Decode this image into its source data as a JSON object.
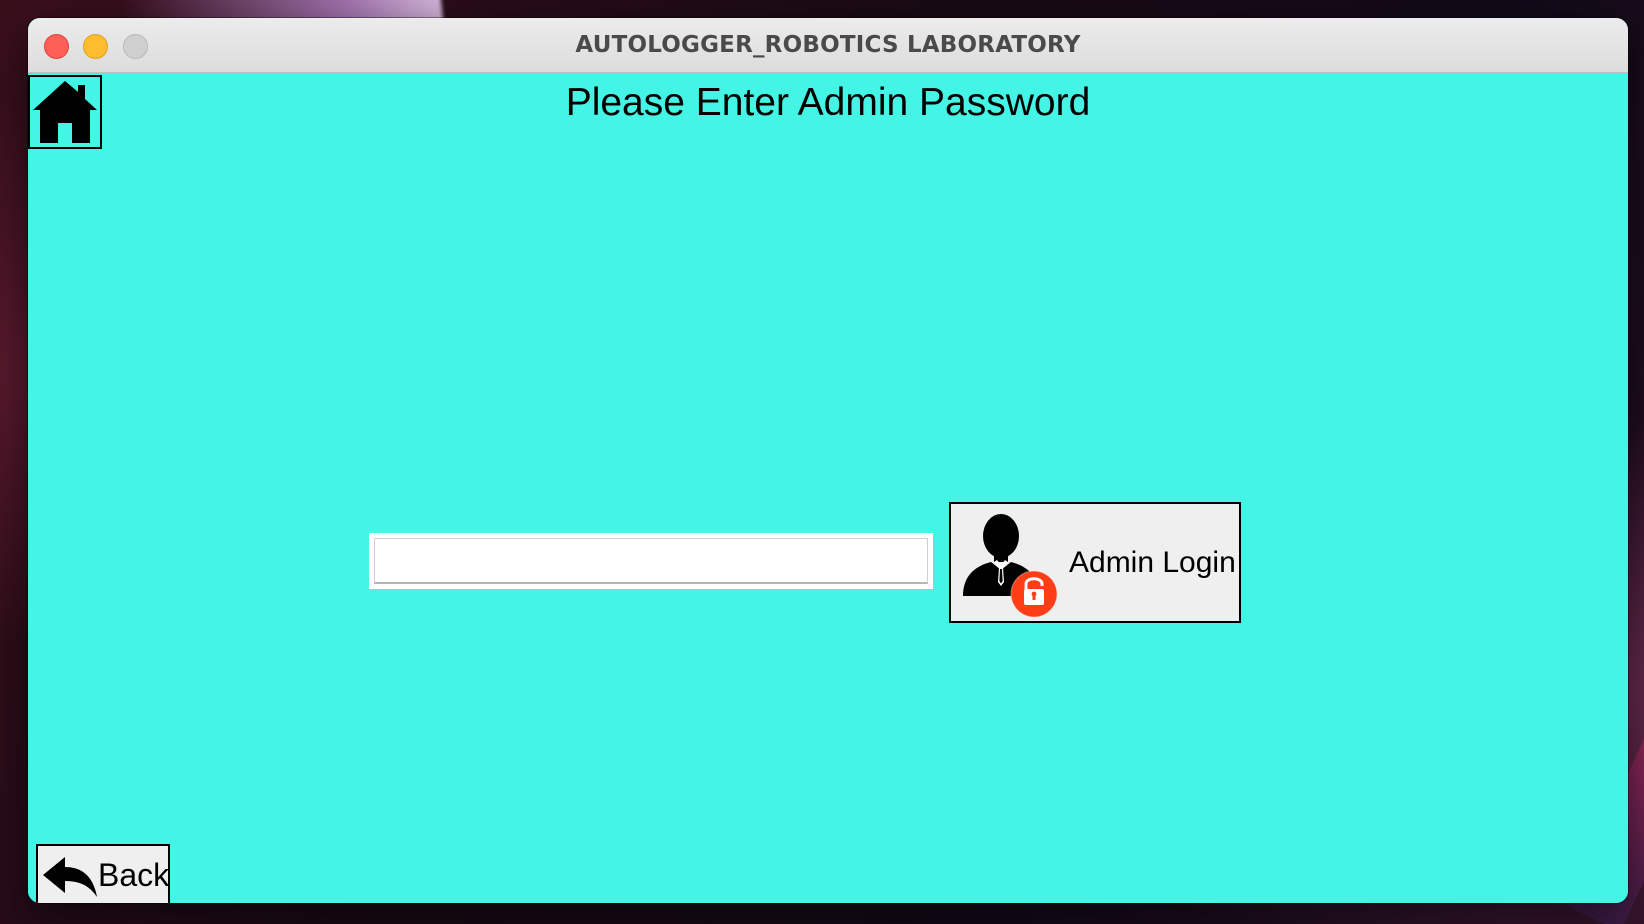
{
  "window": {
    "title": "AUTOLOGGER_ROBOTICS LABORATORY",
    "background_color": "#44f5e6"
  },
  "header": {
    "home_icon": "home-icon",
    "title": "Please Enter Admin Password"
  },
  "login": {
    "password_value": "",
    "button_label": "Admin Login",
    "button_icon": "admin-user-lock-icon",
    "lock_color": "#ff3d17"
  },
  "footer": {
    "back_label": "Back",
    "back_icon": "back-arrow-icon"
  }
}
